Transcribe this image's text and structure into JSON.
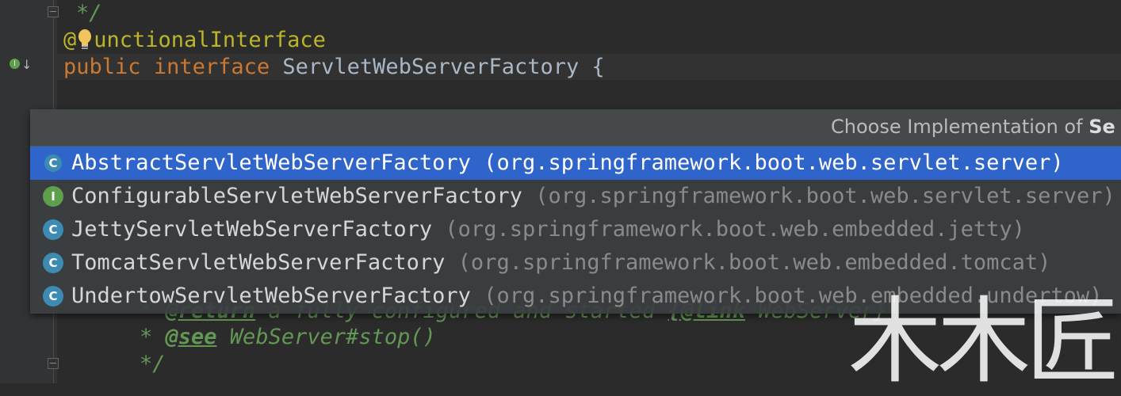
{
  "editor": {
    "lines_top": {
      "comment_end": "*/",
      "annotation_at": "@",
      "annotation_rest": "unctionalInterface",
      "kw_public": "public",
      "kw_interface": "interface",
      "class_name": "ServletWebServerFactory",
      "brace": "{"
    },
    "lines_bottom": {
      "return_line_prefix": "* ",
      "return_tag": "@return",
      "return_text": " a fully configured and started ",
      "link_tag": "{@link",
      "link_target": " WebServer}",
      "see_prefix": "* ",
      "see_tag": "@see",
      "see_text": " WebServer#stop()",
      "comment_end": "*/"
    },
    "gutter": {
      "implemented_badge": "I",
      "implemented_arrow": "↓"
    }
  },
  "popup": {
    "title_prefix": "Choose Implementation of ",
    "title_bold": "Se",
    "items": [
      {
        "icon": "abstract-class-icon",
        "icon_letter": "C",
        "name": "AbstractServletWebServerFactory",
        "package": "(org.springframework.boot.web.servlet.server)",
        "selected": true
      },
      {
        "icon": "interface-icon",
        "icon_letter": "I",
        "name": "ConfigurableServletWebServerFactory",
        "package": "(org.springframework.boot.web.servlet.server)",
        "selected": false
      },
      {
        "icon": "class-icon",
        "icon_letter": "C",
        "name": "JettyServletWebServerFactory",
        "package": "(org.springframework.boot.web.embedded.jetty)",
        "selected": false
      },
      {
        "icon": "class-icon",
        "icon_letter": "C",
        "name": "TomcatServletWebServerFactory",
        "package": "(org.springframework.boot.web.embedded.tomcat)",
        "selected": false
      },
      {
        "icon": "class-icon",
        "icon_letter": "C",
        "name": "UndertowServletWebServerFactory",
        "package": "(org.springframework.boot.web.embedded.undertow)",
        "selected": false
      }
    ]
  },
  "watermark": {
    "text": "木木匠"
  },
  "colors": {
    "editor_bg": "#2b2b2b",
    "gutter_bg": "#313335",
    "selection": "#2f65ca",
    "keyword": "#cc7832",
    "annotation": "#bbb529",
    "comment": "#629755",
    "identifier": "#a9b7c6",
    "class_icon": "#3d8ab3",
    "interface_icon": "#5e9f4b"
  }
}
